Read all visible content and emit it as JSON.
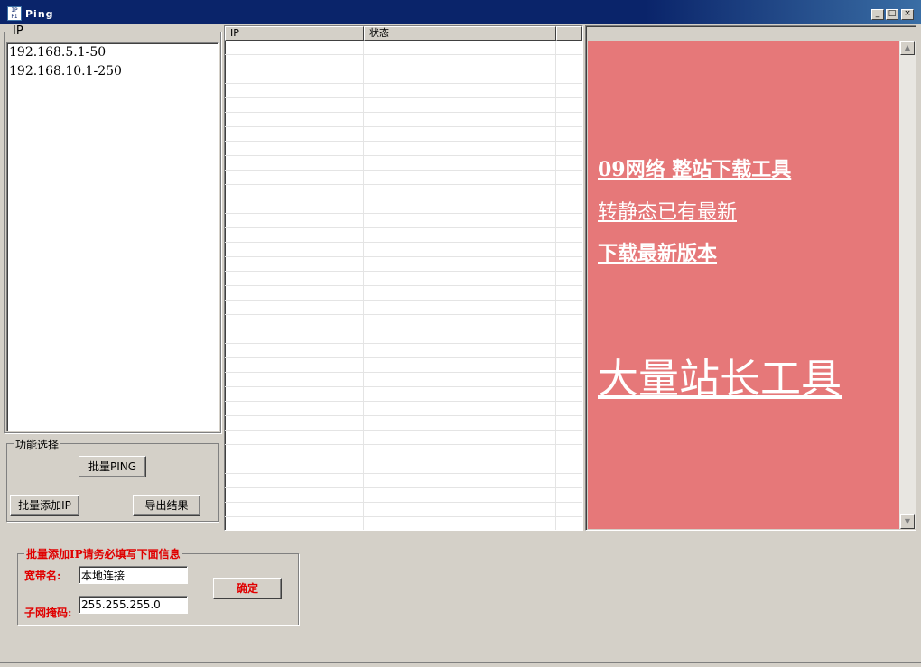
{
  "window": {
    "title": "Ping",
    "icon": "app-icon"
  },
  "ip_group": {
    "legend": "IP",
    "lines": [
      "192.168.5.1-50",
      "192.168.10.1-250"
    ]
  },
  "func_group": {
    "legend": "功能选择",
    "batch_ping_label": "批量PING",
    "batch_add_ip_label": "批量添加IP",
    "export_label": "导出结果"
  },
  "results": {
    "columns": [
      "IP",
      "状态",
      ""
    ]
  },
  "ad": {
    "line1": "09网络 整站下载工具",
    "line2": "转静态已有最新",
    "line3": "下载最新版本",
    "line4": "大量站长工具",
    "bg_color": "#e67879"
  },
  "batch_add": {
    "legend": "批量添加IP请务必填写下面信息",
    "broadband_label": "宽带名:",
    "broadband_value": "本地连接",
    "subnet_label": "子网掩码:",
    "subnet_value": "255.255.255.0",
    "confirm_label": "确定"
  }
}
